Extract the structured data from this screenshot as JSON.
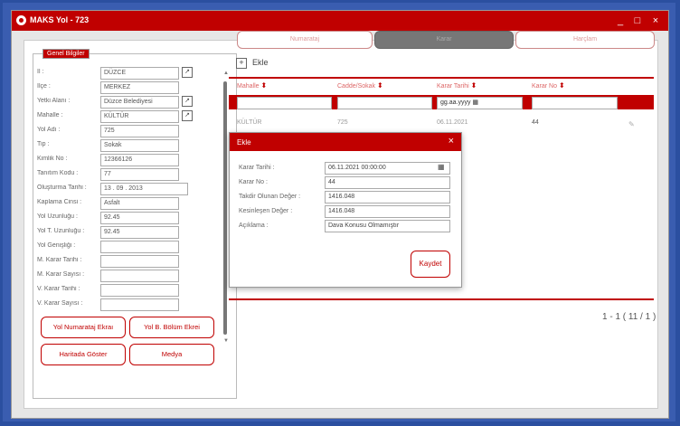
{
  "window": {
    "title": "MAKS Yol - 723"
  },
  "titlebar": {
    "minimize": "_",
    "maximize": "□",
    "close": "×"
  },
  "general": {
    "legend": "Genel Bilgiler",
    "fields": [
      {
        "label": "İl :",
        "value": "DÜZCE"
      },
      {
        "label": "İlçe :",
        "value": "MERKEZ"
      },
      {
        "label": "Yetki Alanı :",
        "value": "Düzce Belediyesi"
      },
      {
        "label": "Mahalle :",
        "value": "KÜLTÜR"
      },
      {
        "label": "Yol Adı :",
        "value": "725"
      },
      {
        "label": "Tip :",
        "value": "Sokak"
      },
      {
        "label": "Kimlik No :",
        "value": "12366126"
      },
      {
        "label": "Tanıtım Kodu :",
        "value": "77"
      },
      {
        "label": "Oluşturma Tarihi :",
        "value": "13 . 09 . 2013"
      },
      {
        "label": "Kaplama Cinsi :",
        "value": "Asfalt"
      },
      {
        "label": "Yol Uzunluğu :",
        "value": "92.45"
      },
      {
        "label": "Yol T. Uzunluğu :",
        "value": "92.45"
      },
      {
        "label": "Yol Genişliği :",
        "value": ""
      },
      {
        "label": "M. Karar Tarihi :",
        "value": ""
      },
      {
        "label": "M. Karar Sayısı :",
        "value": ""
      },
      {
        "label": "V. Karar Tarihi :",
        "value": ""
      },
      {
        "label": "V. Karar Sayısı :",
        "value": ""
      }
    ],
    "buttons": {
      "yol_numarataj": "Yol Numarataj Ekraı",
      "yol_bolum": "Yol B. Bölüm Ekrei",
      "haritada_goster": "Haritada Göster",
      "medya": "Medya"
    }
  },
  "tabs": [
    {
      "label": "Numarataj"
    },
    {
      "label": "Karar"
    },
    {
      "label": "Harçlam"
    }
  ],
  "toolbar": {
    "add_label": "Ekle"
  },
  "table": {
    "headers": [
      "Mahalle",
      "Cadde/Sokak",
      "Karar Tarihi",
      "Karar No"
    ],
    "filter_date": "gg.aa.yyyy",
    "row": [
      "KÜLTÜR",
      "725",
      "06.11.2021",
      "44"
    ]
  },
  "pager": "1 - 1 ( 11 / 1 )",
  "dialog": {
    "title": "Ekle",
    "close": "×",
    "fields": [
      {
        "label": "Karar Tarihi :",
        "value": "06.11.2021 00:00:00"
      },
      {
        "label": "Karar No :",
        "value": "44"
      },
      {
        "label": "Takdir Olunan Değer :",
        "value": "1416.048"
      },
      {
        "label": "Kesinleşen Değer :",
        "value": "1416.048"
      },
      {
        "label": "Açıklama :",
        "value": "Dava Konusu Olmamıştır"
      }
    ],
    "save_label": "Kaydet"
  },
  "colors": {
    "accent": "#c00000",
    "frame": "#2b4fa0"
  }
}
